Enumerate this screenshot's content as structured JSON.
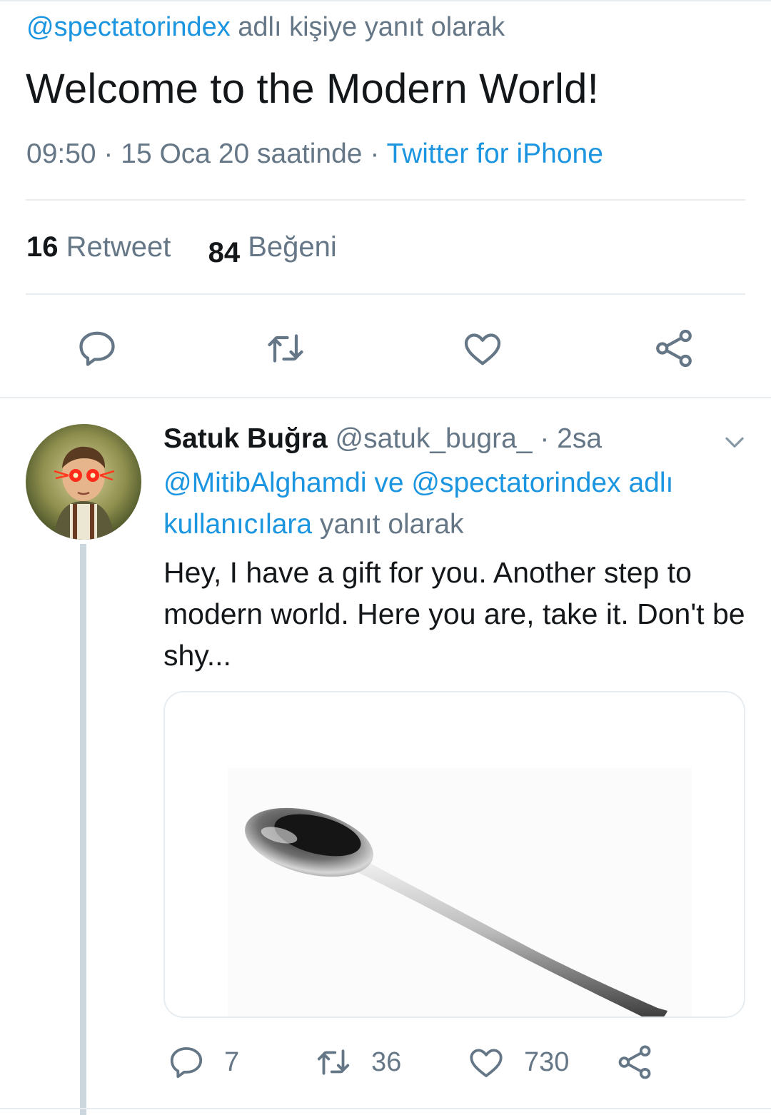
{
  "main_tweet": {
    "reply_handle": "@spectatorindex",
    "reply_suffix": " adlı kişiye yanıt olarak",
    "text": "Welcome to the Modern World!",
    "time": "09:50 · 15 Oca 20 saatinde · ",
    "source": "Twitter for iPhone",
    "retweet_count": "16",
    "retweet_label": "Retweet",
    "like_count": "84",
    "like_label": "Beğeni",
    "actions": [
      "reply-icon",
      "retweet-icon",
      "like-icon",
      "share-icon"
    ]
  },
  "reply_tweet": {
    "name": "Satuk Buğra",
    "handle": " @satuk_bugra_ · 2sa",
    "reply_handles": "@MitibAlghamdi ve @spectatorindex adlı kullanıcılara",
    "reply_suffix": " yanıt olarak",
    "text": "Hey, I have a gift for you. Another step to modern world. Here you are, take it. Don't be shy...",
    "reply_count": "7",
    "retweet_count": "36",
    "like_count": "730"
  },
  "colors": {
    "link": "#1b95e0",
    "secondary_text": "#657786",
    "divider": "#e6ecf0",
    "thread_line": "#ccd6dd"
  }
}
